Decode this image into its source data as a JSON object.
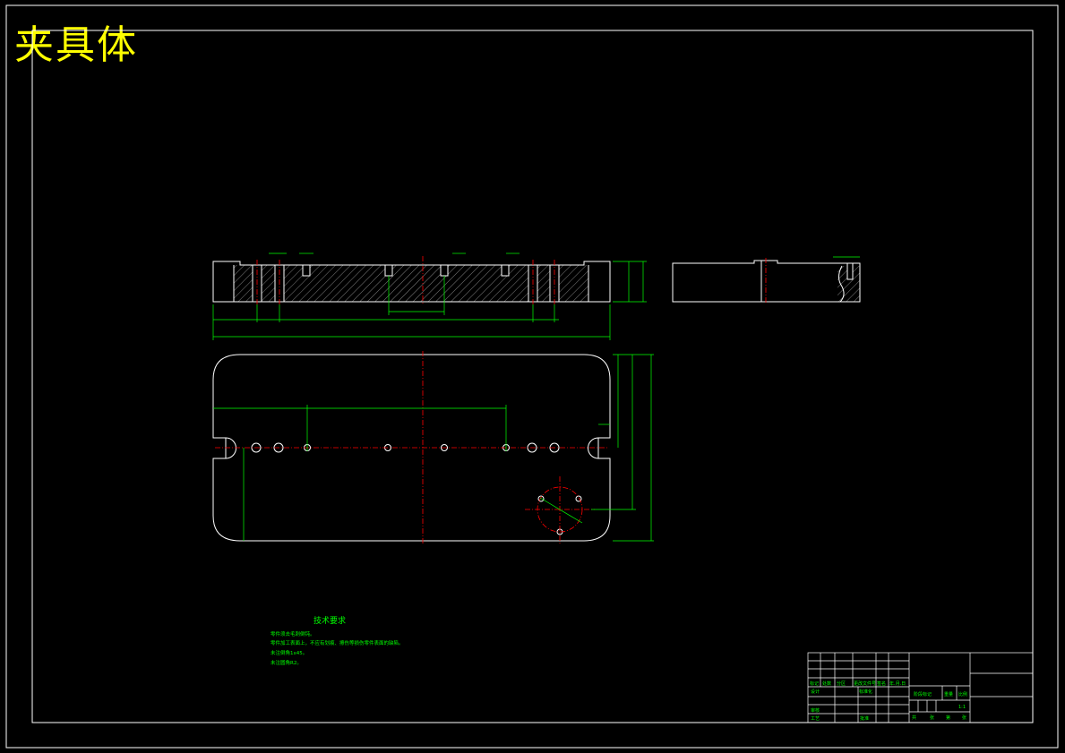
{
  "drawing": {
    "title": "夹具体",
    "technical_requirements": {
      "heading": "技术要求",
      "notes": [
        "零件须去毛刺倒钝。",
        "零件加工表面上，不应有划痕、擦伤等损伤零件表面的缺陷。",
        "未注倒角1x45。",
        "未注圆角R2。"
      ]
    },
    "title_block": {
      "scale": "1:1",
      "header_cells": [
        "标记",
        "处数",
        "分区",
        "更改文件号",
        "签名",
        "年.月.日"
      ],
      "role_cells": [
        "设计",
        "审核",
        "工艺"
      ],
      "standardization": "标准化",
      "approve": "批准",
      "stage_cells": [
        "阶段标记",
        "重量",
        "比例"
      ],
      "sheet_cells": [
        "共",
        "张",
        "第",
        "张"
      ]
    },
    "colors": {
      "background": "#000000",
      "outline": "#ffffff",
      "dimension": "#00ff00",
      "centerline": "#ff0000",
      "title": "#ffff00"
    }
  }
}
